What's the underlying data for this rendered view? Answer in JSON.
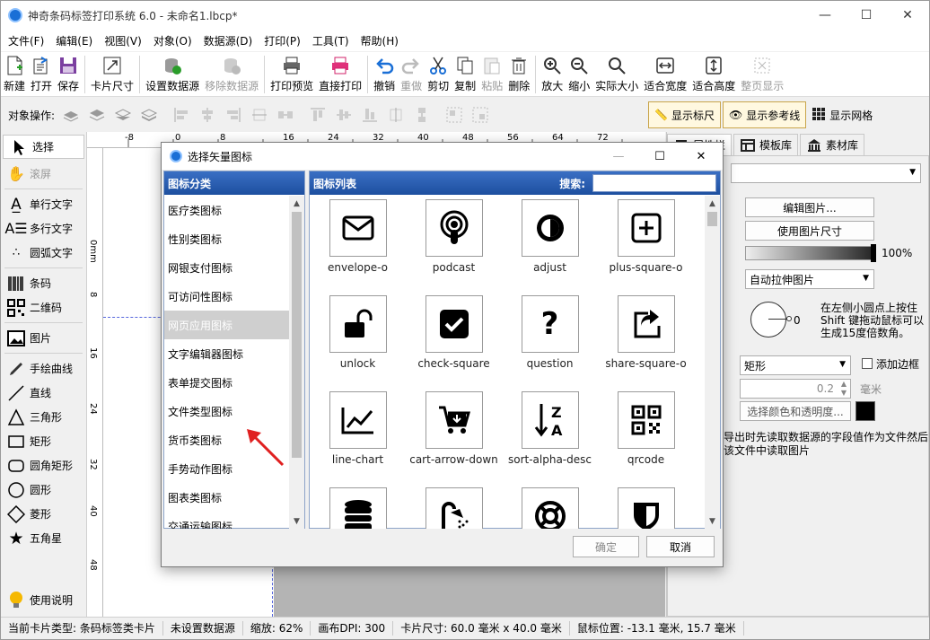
{
  "window": {
    "title": "神奇条码标签打印系统 6.0 - 未命名1.lbcp*",
    "minimize": "—",
    "maximize": "☐",
    "close": "✕"
  },
  "menu": [
    "文件(F)",
    "编辑(E)",
    "视图(V)",
    "对象(O)",
    "数据源(D)",
    "打印(P)",
    "工具(T)",
    "帮助(H)"
  ],
  "toolbar": [
    {
      "label": "新建",
      "icon": "new-file-icon",
      "disabled": false
    },
    {
      "label": "打开",
      "icon": "open-icon",
      "disabled": false
    },
    {
      "label": "保存",
      "icon": "save-icon",
      "disabled": false
    },
    {
      "label": "卡片尺寸",
      "icon": "card-size-icon",
      "disabled": false
    },
    {
      "label": "设置数据源",
      "icon": "database-icon",
      "disabled": false
    },
    {
      "label": "移除数据源",
      "icon": "database-remove-icon",
      "disabled": true
    },
    {
      "label": "打印预览",
      "icon": "print-preview-icon",
      "disabled": false
    },
    {
      "label": "直接打印",
      "icon": "printer-icon",
      "disabled": false
    },
    {
      "label": "撤销",
      "icon": "undo-icon",
      "disabled": false
    },
    {
      "label": "重做",
      "icon": "redo-icon",
      "disabled": true
    },
    {
      "label": "剪切",
      "icon": "scissors-icon",
      "disabled": false
    },
    {
      "label": "复制",
      "icon": "copy-icon",
      "disabled": false
    },
    {
      "label": "粘贴",
      "icon": "paste-icon",
      "disabled": true
    },
    {
      "label": "删除",
      "icon": "trash-icon",
      "disabled": false
    },
    {
      "label": "放大",
      "icon": "zoom-in-icon",
      "disabled": false
    },
    {
      "label": "缩小",
      "icon": "zoom-out-icon",
      "disabled": false
    },
    {
      "label": "实际大小",
      "icon": "zoom-actual-icon",
      "disabled": false
    },
    {
      "label": "适合宽度",
      "icon": "fit-width-icon",
      "disabled": false
    },
    {
      "label": "适合高度",
      "icon": "fit-height-icon",
      "disabled": false
    },
    {
      "label": "整页显示",
      "icon": "fit-page-icon",
      "disabled": true
    }
  ],
  "toolbar2": {
    "label": "对象操作:",
    "show_ruler": "显示标尺",
    "show_guides": "显示参考线",
    "show_grid": "显示网格"
  },
  "left_tools": [
    {
      "label": "选择",
      "icon": "pointer-icon",
      "selected": true
    },
    {
      "label": "滚屏",
      "icon": "hand-icon",
      "disabled": true
    },
    {
      "label": "单行文字",
      "icon": "single-line-text-icon"
    },
    {
      "label": "多行文字",
      "icon": "multi-line-text-icon"
    },
    {
      "label": "圆弧文字",
      "icon": "arc-text-icon"
    },
    {
      "label": "条码",
      "icon": "barcode-icon"
    },
    {
      "label": "二维码",
      "icon": "qrcode-icon"
    },
    {
      "label": "图片",
      "icon": "image-icon"
    },
    {
      "label": "手绘曲线",
      "icon": "pen-icon"
    },
    {
      "label": "直线",
      "icon": "line-icon"
    },
    {
      "label": "三角形",
      "icon": "triangle-icon"
    },
    {
      "label": "矩形",
      "icon": "rectangle-icon"
    },
    {
      "label": "圆角矩形",
      "icon": "rounded-rectangle-icon"
    },
    {
      "label": "圆形",
      "icon": "circle-icon"
    },
    {
      "label": "菱形",
      "icon": "diamond-icon"
    },
    {
      "label": "五角星",
      "icon": "star-icon"
    },
    {
      "label": "使用说明",
      "icon": "lightbulb-icon"
    }
  ],
  "ruler_top": [
    "-8",
    "0",
    "8",
    "16",
    "24",
    "32",
    "40",
    "48",
    "56",
    "64",
    "72"
  ],
  "ruler_left": [
    "0mm",
    "8",
    "16",
    "24",
    "32",
    "40",
    "48"
  ],
  "right_panel": {
    "tabs": [
      {
        "label": "属性栏",
        "icon": "property-icon"
      },
      {
        "label": "模板库",
        "icon": "template-icon"
      },
      {
        "label": "素材库",
        "icon": "library-icon"
      }
    ],
    "edit_image": "编辑图片...",
    "use_image_size": "使用图片尺寸",
    "opacity": "100%",
    "stretch_mode": "自动拉伸图片",
    "rotate_value": "0",
    "rotate_hint": "在左侧小圆点上按住Shift 键拖动鼠标可以生成15度倍数角。",
    "border_shape": "矩形",
    "add_border": "添加边框",
    "border_width": "0.2",
    "border_unit": "毫米",
    "pick_color": "选择颜色和透明度...",
    "border_color": "#000000",
    "datasource_note": "或导出时先读取数据源的字段值作为文件然后从该文件中读取图片"
  },
  "status": {
    "card_type": "当前卡片类型: 条码标签类卡片",
    "datasource": "未设置数据源",
    "zoom": "缩放: 62%",
    "dpi": "画布DPI: 300",
    "card_size": "卡片尺寸: 60.0 毫米 x 40.0 毫米",
    "mouse_pos": "鼠标位置: -13.1 毫米, 15.7 毫米"
  },
  "dialog": {
    "title": "选择矢量图标",
    "category_header": "图标分类",
    "list_header": "图标列表",
    "search_label": "搜索:",
    "search_value": "",
    "ok": "确定",
    "cancel": "取消",
    "categories": [
      "医疗类图标",
      "性别类图标",
      "网银支付图标",
      "可访问性图标",
      "网页应用图标",
      "文字编辑器图标",
      "表单提交图标",
      "文件类型图标",
      "货币类图标",
      "手势动作图标",
      "图表类图标",
      "交通运输图标"
    ],
    "selected_category": 4,
    "icons": [
      "envelope-o",
      "podcast",
      "adjust",
      "plus-square-o",
      "unlock",
      "check-square",
      "question",
      "share-square-o",
      "line-chart",
      "cart-arrow-down",
      "sort-alpha-desc",
      "qrcode",
      "database",
      "shower",
      "life-ring",
      "shield"
    ]
  }
}
